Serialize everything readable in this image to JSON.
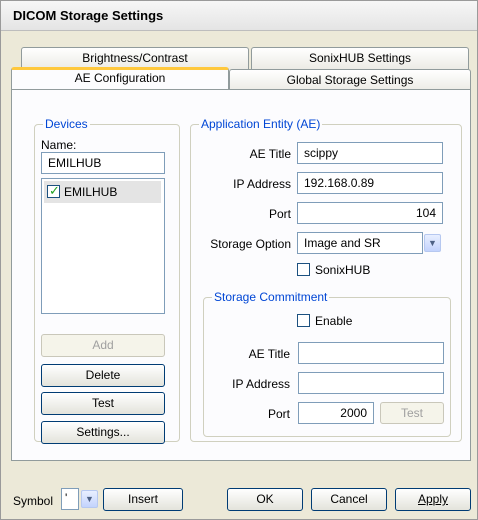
{
  "window": {
    "title": "DICOM Storage Settings"
  },
  "tabs": {
    "row_back": [
      {
        "label": "Brightness/Contrast"
      },
      {
        "label": "SonixHUB Settings"
      }
    ],
    "row_front": [
      {
        "label": "AE Configuration",
        "active": true
      },
      {
        "label": "Global Storage Settings"
      }
    ]
  },
  "devices": {
    "legend": "Devices",
    "name_label": "Name:",
    "name_value": "EMILHUB",
    "list": [
      {
        "label": "EMILHUB",
        "checked": true
      }
    ],
    "buttons": {
      "add": "Add",
      "delete": "Delete",
      "test": "Test",
      "settings": "Settings..."
    }
  },
  "ae": {
    "legend": "Application Entity (AE)",
    "ae_title_label": "AE Title",
    "ae_title_value": "scippy",
    "ip_label": "IP Address",
    "ip_value": "192.168.0.89",
    "port_label": "Port",
    "port_value": "104",
    "storage_option_label": "Storage Option",
    "storage_option_value": "Image and SR",
    "sonixhub_label": "SonixHUB",
    "sonixhub_checked": false
  },
  "commitment": {
    "legend": "Storage Commitment",
    "enable_label": "Enable",
    "enable_checked": false,
    "ae_title_label": "AE Title",
    "ae_title_value": "",
    "ip_label": "IP Address",
    "ip_value": "",
    "port_label": "Port",
    "port_value": "2000",
    "test_label": "Test"
  },
  "footer": {
    "symbol_label": "Symbol",
    "symbol_value": "'",
    "insert_label": "Insert",
    "ok_label": "OK",
    "cancel_label": "Cancel",
    "apply_label": "Apply"
  },
  "colors": {
    "group_legend": "#0046d5",
    "active_tab_highlight": "#ffc83c",
    "window_bg": "#ece9d8"
  }
}
